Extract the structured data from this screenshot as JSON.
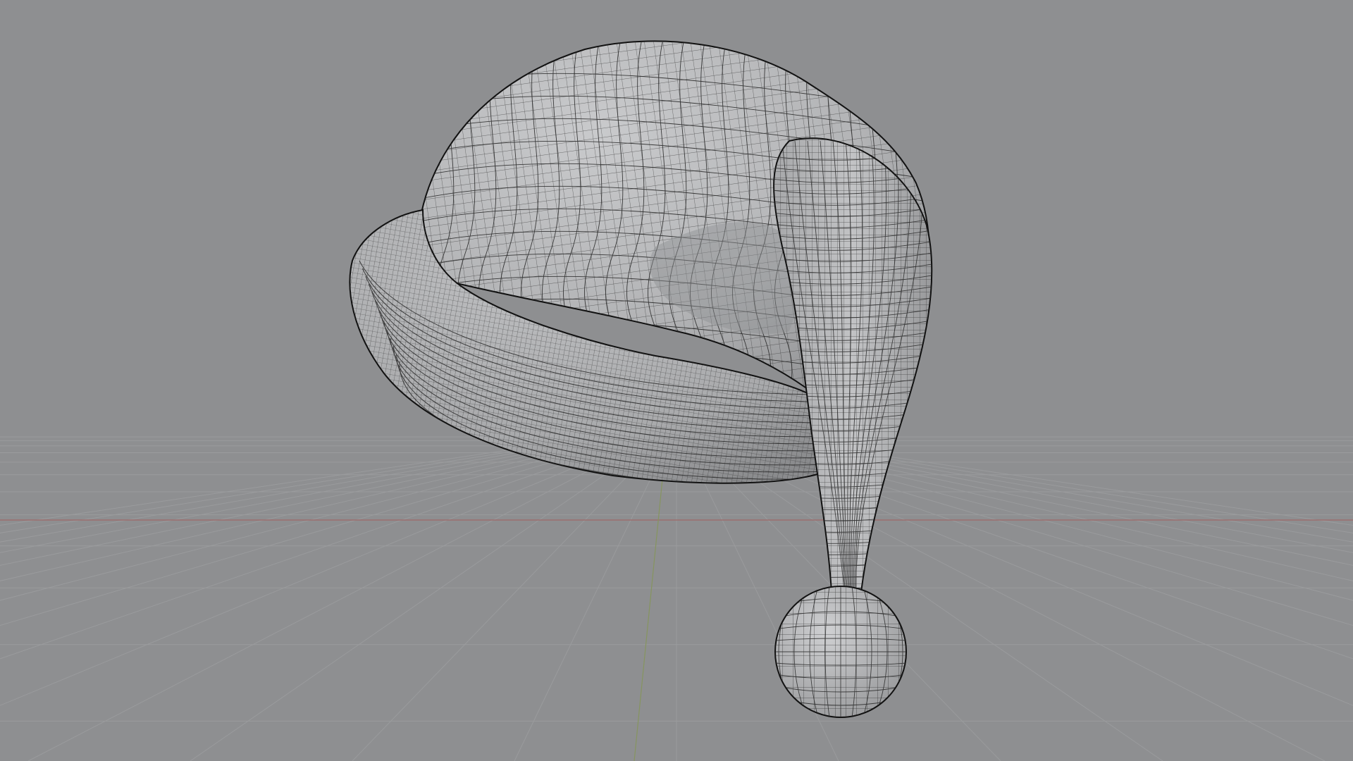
{
  "viewport": {
    "background_color": "#8e8f91",
    "grid_color": "#9a9b9d",
    "x_axis_color": "#9b6f6f",
    "y_axis_color": "#86955f",
    "mesh_fill_color": "#b6b7b9",
    "wire_color": "#222222",
    "object_name": "santa-hat-wireframe-mesh"
  }
}
